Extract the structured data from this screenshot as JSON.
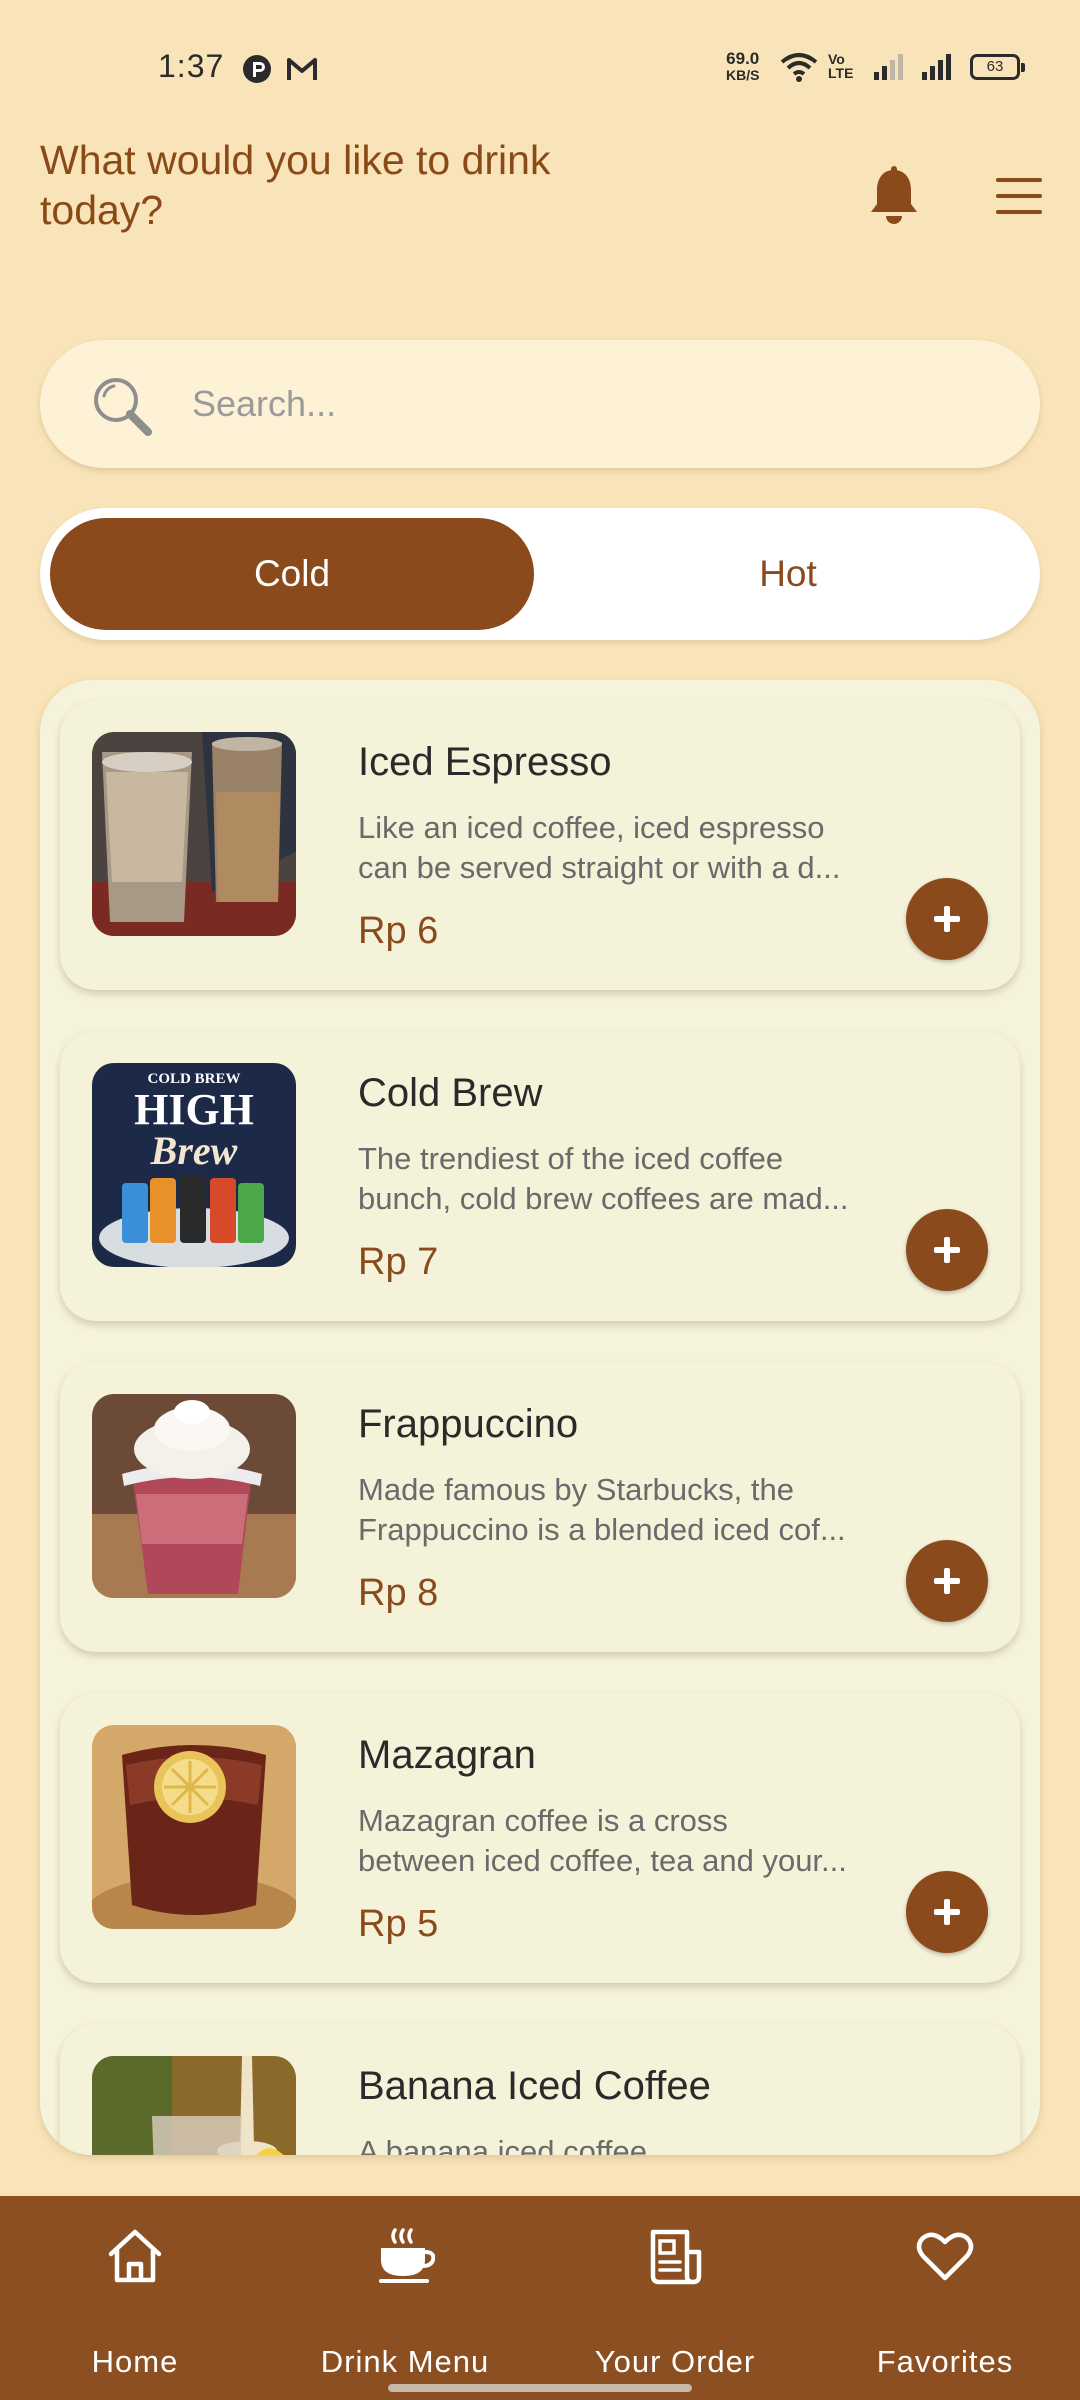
{
  "status_bar": {
    "time": "1:37",
    "net_speed_value": "69.0",
    "net_speed_unit": "KB/S",
    "volte": "Vo LTE",
    "battery": "63"
  },
  "header": {
    "title_line1": "What would you like to drink",
    "title_line2": "today?"
  },
  "search": {
    "placeholder": "Search..."
  },
  "tabs": [
    {
      "label": "Cold",
      "selected": true
    },
    {
      "label": "Hot",
      "selected": false
    }
  ],
  "drinks": [
    {
      "name": "Iced Espresso",
      "desc_line1": "Like an iced coffee, iced espresso",
      "desc_line2": "can be served straight or with a d...",
      "price": "Rp 6",
      "add_label": "+"
    },
    {
      "name": "Cold Brew",
      "desc_line1": "The trendiest of the iced coffee",
      "desc_line2": "bunch, cold brew coffees are mad...",
      "price": "Rp 7",
      "add_label": "+",
      "image_text": "COLD BREW HIGH Brew"
    },
    {
      "name": "Frappuccino",
      "desc_line1": "Made famous by Starbucks, the",
      "desc_line2": "Frappuccino is a blended iced cof...",
      "price": "Rp 8",
      "add_label": "+"
    },
    {
      "name": "Mazagran",
      "desc_line1": "Mazagran coffee is a cross",
      "desc_line2": "between iced coffee, tea and your...",
      "price": "Rp 5",
      "add_label": "+"
    },
    {
      "name": "Banana Iced Coffee",
      "desc_line1": "A banana iced coffee",
      "desc_line2": "",
      "price": "",
      "add_label": ""
    }
  ],
  "bottom_nav": [
    {
      "label": "Home",
      "icon": "home-icon"
    },
    {
      "label": "Drink Menu",
      "icon": "coffee-cup-icon"
    },
    {
      "label": "Your Order",
      "icon": "receipt-icon"
    },
    {
      "label": "Favorites",
      "icon": "heart-icon"
    }
  ],
  "colors": {
    "background": "#f8e4b8",
    "brand_brown": "#8b4a1c",
    "nav_background": "#8b4f21",
    "card_background": "#f5f2da",
    "search_background": "#fdf2d5"
  }
}
